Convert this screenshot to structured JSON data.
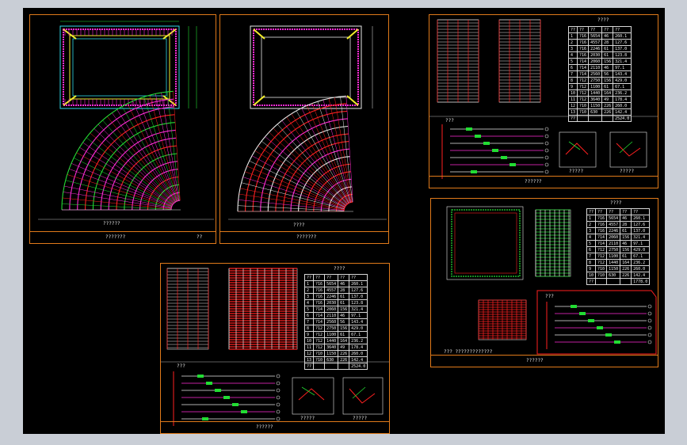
{
  "colors": {
    "frame": "#e07a1a",
    "background": "#000000",
    "outer_background": "#c9ced6",
    "rebar_magenta": "#ff2bd6",
    "rebar_red": "#ff2020",
    "rebar_green": "#22dd33",
    "rebar_cyan": "#2fd9e8",
    "rebar_yellow": "#f2ee2a"
  },
  "sheet_a": {
    "section_caption": "??????",
    "title_block": "???????",
    "sheet_no": "??"
  },
  "sheet_b": {
    "caption": "????",
    "title_block": "???????"
  },
  "sheet_c": {
    "headline": "????",
    "table": [
      [
        "??",
        "??",
        "??",
        "??",
        "??"
      ],
      [
        "1",
        "?16",
        "5654",
        "46",
        "260.1"
      ],
      [
        "2",
        "?16",
        "4557",
        "28",
        "127.6"
      ],
      [
        "3",
        "?16",
        "2246",
        "61",
        "137.0"
      ],
      [
        "4",
        "?16",
        "2030",
        "61",
        "123.8"
      ],
      [
        "5",
        "?14",
        "2060",
        "156",
        "321.4"
      ],
      [
        "6",
        "?14",
        "2110",
        "46",
        "97.1"
      ],
      [
        "7",
        "?14",
        "2560",
        "56",
        "143.4"
      ],
      [
        "8",
        "?12",
        "2750",
        "156",
        "429.0"
      ],
      [
        "9",
        "?12",
        "1100",
        "61",
        "67.1"
      ],
      [
        "10",
        "?12",
        "1440",
        "164",
        "236.2"
      ],
      [
        "11",
        "?12",
        "3640",
        "49",
        "178.4"
      ],
      [
        "12",
        "?10",
        "1150",
        "226",
        "260.0"
      ],
      [
        "13",
        "?10",
        "630",
        "226",
        "142.4"
      ],
      [
        "??",
        "",
        "",
        "",
        "2524.0"
      ]
    ],
    "scheme_caption": "???",
    "detail_caption_1": "?????",
    "detail_caption_2": "?????",
    "title_block": "??????"
  },
  "sheet_d": {
    "headline": "????",
    "table": [
      [
        "??",
        "??",
        "??",
        "??",
        "??"
      ],
      [
        "1",
        "?16",
        "5654",
        "46",
        "260.1"
      ],
      [
        "2",
        "?16",
        "4557",
        "28",
        "127.6"
      ],
      [
        "3",
        "?16",
        "2246",
        "61",
        "137.0"
      ],
      [
        "4",
        "?14",
        "2060",
        "156",
        "321.4"
      ],
      [
        "5",
        "?14",
        "2110",
        "46",
        "97.1"
      ],
      [
        "6",
        "?12",
        "2750",
        "156",
        "429.0"
      ],
      [
        "7",
        "?12",
        "1100",
        "61",
        "67.1"
      ],
      [
        "8",
        "?12",
        "1440",
        "164",
        "236.2"
      ],
      [
        "9",
        "?10",
        "1150",
        "226",
        "260.0"
      ],
      [
        "10",
        "?10",
        "630",
        "226",
        "142.4"
      ],
      [
        "??",
        "",
        "",
        "",
        "1778.0"
      ]
    ],
    "scheme_caption": "???",
    "note": "???  ?????????????",
    "title_block": "??????"
  },
  "sheet_e": {
    "headline": "????",
    "table": [
      [
        "??",
        "??",
        "??",
        "??",
        "??"
      ],
      [
        "1",
        "?16",
        "5654",
        "46",
        "260.1"
      ],
      [
        "2",
        "?16",
        "4557",
        "28",
        "127.6"
      ],
      [
        "3",
        "?16",
        "2246",
        "61",
        "137.0"
      ],
      [
        "4",
        "?16",
        "2030",
        "61",
        "123.8"
      ],
      [
        "5",
        "?14",
        "2060",
        "156",
        "321.4"
      ],
      [
        "6",
        "?14",
        "2110",
        "46",
        "97.1"
      ],
      [
        "7",
        "?14",
        "2560",
        "56",
        "143.4"
      ],
      [
        "8",
        "?12",
        "2750",
        "156",
        "429.0"
      ],
      [
        "9",
        "?12",
        "1100",
        "61",
        "67.1"
      ],
      [
        "10",
        "?12",
        "1440",
        "164",
        "236.2"
      ],
      [
        "11",
        "?12",
        "3640",
        "49",
        "178.4"
      ],
      [
        "12",
        "?10",
        "1150",
        "226",
        "260.0"
      ],
      [
        "13",
        "?10",
        "630",
        "226",
        "142.4"
      ],
      [
        "??",
        "",
        "",
        "",
        "2524.0"
      ]
    ],
    "scheme_caption": "???",
    "detail_caption_1": "?????",
    "detail_caption_2": "?????",
    "title_block": "??????"
  }
}
